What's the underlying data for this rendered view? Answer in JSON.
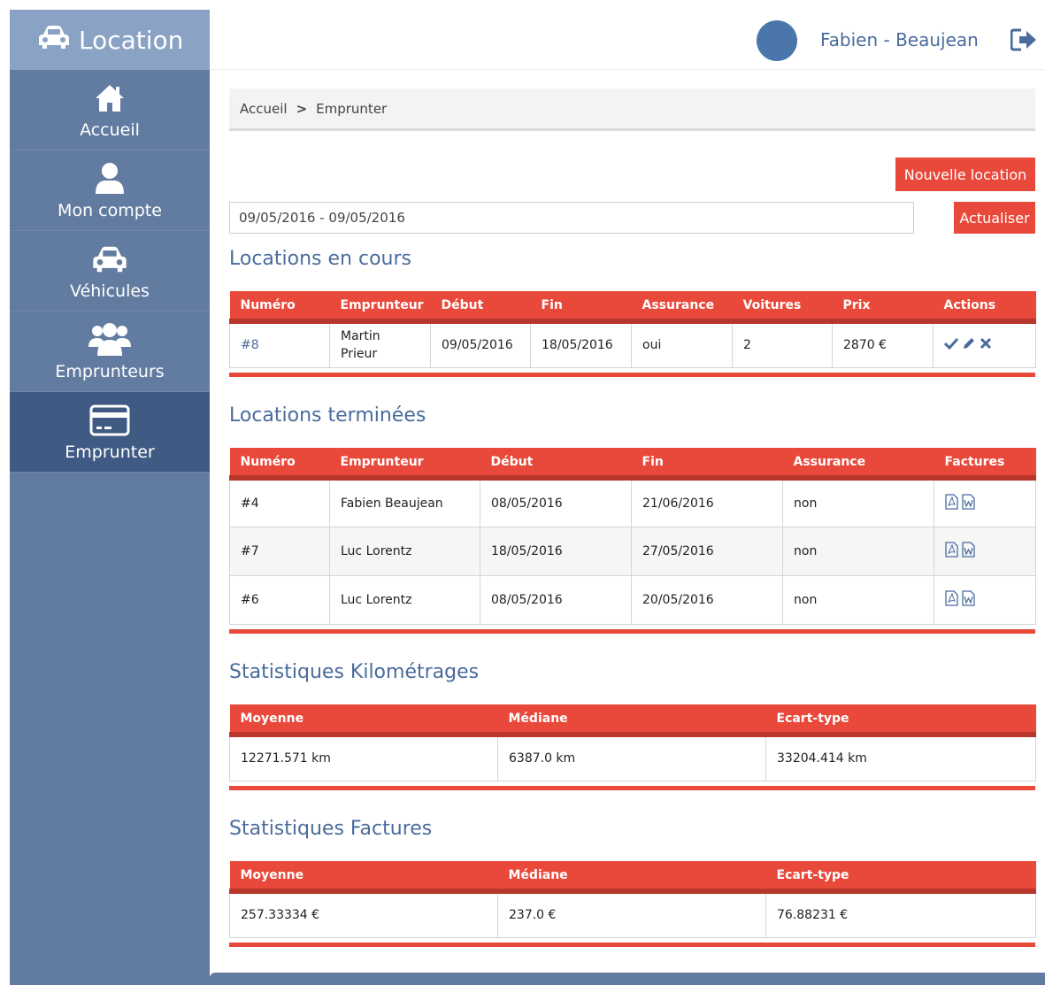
{
  "brand": {
    "title": "Location"
  },
  "sidebar": {
    "items": [
      {
        "label": "Accueil",
        "icon": "home-icon"
      },
      {
        "label": "Mon compte",
        "icon": "user-icon"
      },
      {
        "label": "Véhicules",
        "icon": "car-icon"
      },
      {
        "label": "Emprunteurs",
        "icon": "users-icon"
      },
      {
        "label": "Emprunter",
        "icon": "credit-card-icon",
        "active": true
      }
    ]
  },
  "header": {
    "username": "Fabien - Beaujean"
  },
  "breadcrumb": {
    "items": [
      "Accueil",
      "Emprunter"
    ]
  },
  "actions": {
    "new_label": "Nouvelle location",
    "refresh_label": "Actualiser"
  },
  "filter": {
    "date_range": "09/05/2016 - 09/05/2016"
  },
  "current": {
    "title": "Locations en cours",
    "headers": [
      "Numéro",
      "Emprunteur",
      "Début",
      "Fin",
      "Assurance",
      "Voitures",
      "Prix",
      "Actions"
    ],
    "rows": [
      {
        "numero": "#8",
        "emprunteur_line1": "Martin",
        "emprunteur_line2": "Prieur",
        "debut": "09/05/2016",
        "fin": "18/05/2016",
        "assurance": "oui",
        "voitures": "2",
        "prix": "2870 €"
      }
    ]
  },
  "finished": {
    "title": "Locations terminées",
    "headers": [
      "Numéro",
      "Emprunteur",
      "Début",
      "Fin",
      "Assurance",
      "Factures"
    ],
    "rows": [
      {
        "numero": "#4",
        "emprunteur": "Fabien Beaujean",
        "debut": "08/05/2016",
        "fin": "21/06/2016",
        "assurance": "non"
      },
      {
        "numero": "#7",
        "emprunteur": "Luc Lorentz",
        "debut": "18/05/2016",
        "fin": "27/05/2016",
        "assurance": "non"
      },
      {
        "numero": "#6",
        "emprunteur": "Luc Lorentz",
        "debut": "08/05/2016",
        "fin": "20/05/2016",
        "assurance": "non"
      }
    ]
  },
  "km_stats": {
    "title": "Statistiques Kilométrages",
    "headers": [
      "Moyenne",
      "Médiane",
      "Ecart-type"
    ],
    "values": [
      "12271.571 km",
      "6387.0 km",
      "33204.414 km"
    ]
  },
  "invoice_stats": {
    "title": "Statistiques Factures",
    "headers": [
      "Moyenne",
      "Médiane",
      "Ecart-type"
    ],
    "values": [
      "257.33334 €",
      "237.0 €",
      "76.88231 €"
    ]
  },
  "colors": {
    "accent": "#e8493b",
    "sidebar": "#627ba0",
    "sidebar_active": "#3f5b83",
    "brand": "#8aa2c4",
    "title_text": "#4a6c9c"
  }
}
